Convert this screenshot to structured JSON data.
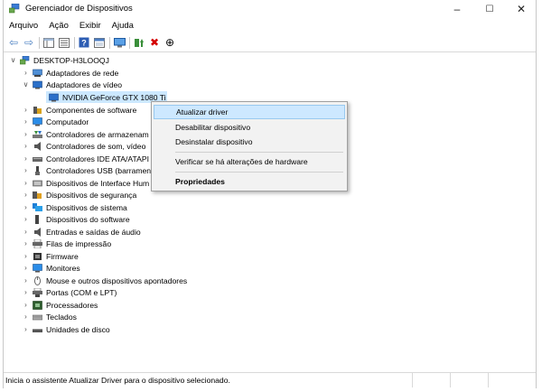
{
  "window": {
    "title": "Gerenciador de Dispositivos"
  },
  "window_controls": {
    "minimize": "–",
    "maximize": "☐",
    "close": "✕"
  },
  "menu": [
    "Arquivo",
    "Ação",
    "Exibir",
    "Ajuda"
  ],
  "toolbar": {
    "back": "⇦",
    "forward": "⇨",
    "delete": "✖",
    "download": "⊕"
  },
  "tree": {
    "root": "DESKTOP-H3LOOQJ",
    "network": "Adaptadores de rede",
    "video": "Adaptadores de vídeo",
    "gpu": "NVIDIA GeForce GTX 1080 Ti",
    "software_components": "Componentes de software",
    "computer": "Computador",
    "storage": "Controladores de armazenam",
    "audio": "Controladores de som, vídeo",
    "ide": "Controladores IDE ATA/ATAPI",
    "usb": "Controladores USB (barramen",
    "hid": "Dispositivos de Interface Hum",
    "security": "Dispositivos de segurança",
    "system": "Dispositivos de sistema",
    "software_devices": "Dispositivos do software",
    "audio_io": "Entradas e saídas de áudio",
    "print_queues": "Filas de impressão",
    "firmware": "Firmware",
    "monitors": "Monitores",
    "mice": "Mouse e outros dispositivos apontadores",
    "ports": "Portas (COM e LPT)",
    "processors": "Processadores",
    "keyboards": "Teclados",
    "disks": "Unidades de disco"
  },
  "context_menu": {
    "update": "Atualizar driver",
    "disable": "Desabilitar dispositivo",
    "uninstall": "Desinstalar dispositivo",
    "scan": "Verificar se há alterações de hardware",
    "properties": "Propriedades"
  },
  "status": {
    "text": "Inicia o assistente Atualizar Driver para o dispositivo selecionado."
  }
}
